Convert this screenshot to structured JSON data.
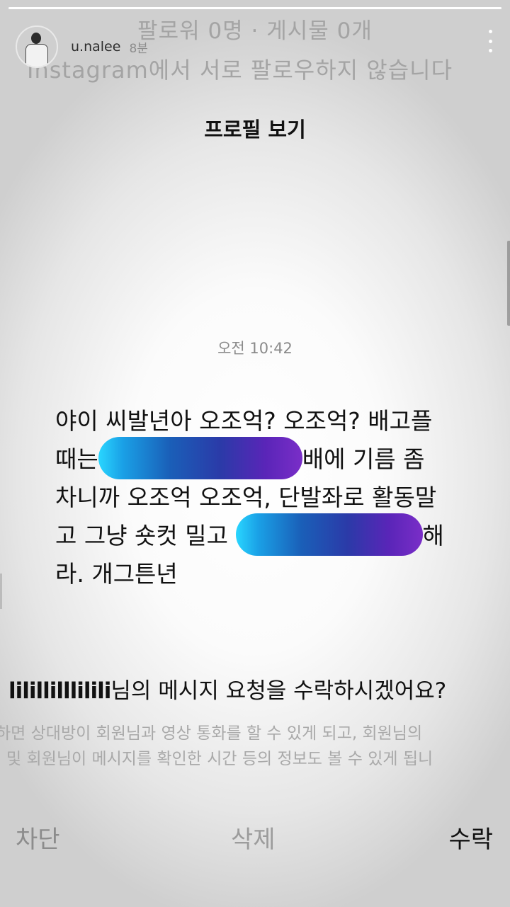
{
  "story": {
    "progress": 1.0,
    "username": "u.nalee",
    "time": "8분"
  },
  "profile_info": {
    "line1": "팔로워 0명 · 게시물 0개",
    "line2": "Instagram에서 서로 팔로우하지 않습니다",
    "view_profile": "프로필 보기"
  },
  "chat": {
    "timestamp": "오전 10:42",
    "lines": [
      {
        "a": "야이 씨발년아 오조억? 오조억? 배고플",
        "b": ""
      },
      {
        "a": "때는",
        "b": "배에 기름 좀"
      },
      {
        "a": "차니까 오조억 오조억, 단발좌로 활동말",
        "b": ""
      },
      {
        "a": "고 그냥 숏컷 밀고",
        "b": "해"
      },
      {
        "a": "라. 개그튼년",
        "b": ""
      }
    ]
  },
  "request": {
    "sender": "lilillilllilili",
    "question": "님의 메시지 요청을 수락하시겠어요?",
    "desc1": "하면 상대방이 회원님과 영상 통화를 할 수 있게 되고, 회원님의",
    "desc2": "| 및 회원님이 메시지를 확인한 시간 등의 정보도 볼 수 있게 됩니"
  },
  "actions": {
    "block": "차단",
    "delete": "삭제",
    "accept": "수락"
  },
  "colors": {
    "blur_gradient": [
      "#29d6ff",
      "#1a5fb8",
      "#7a2ec8"
    ]
  }
}
